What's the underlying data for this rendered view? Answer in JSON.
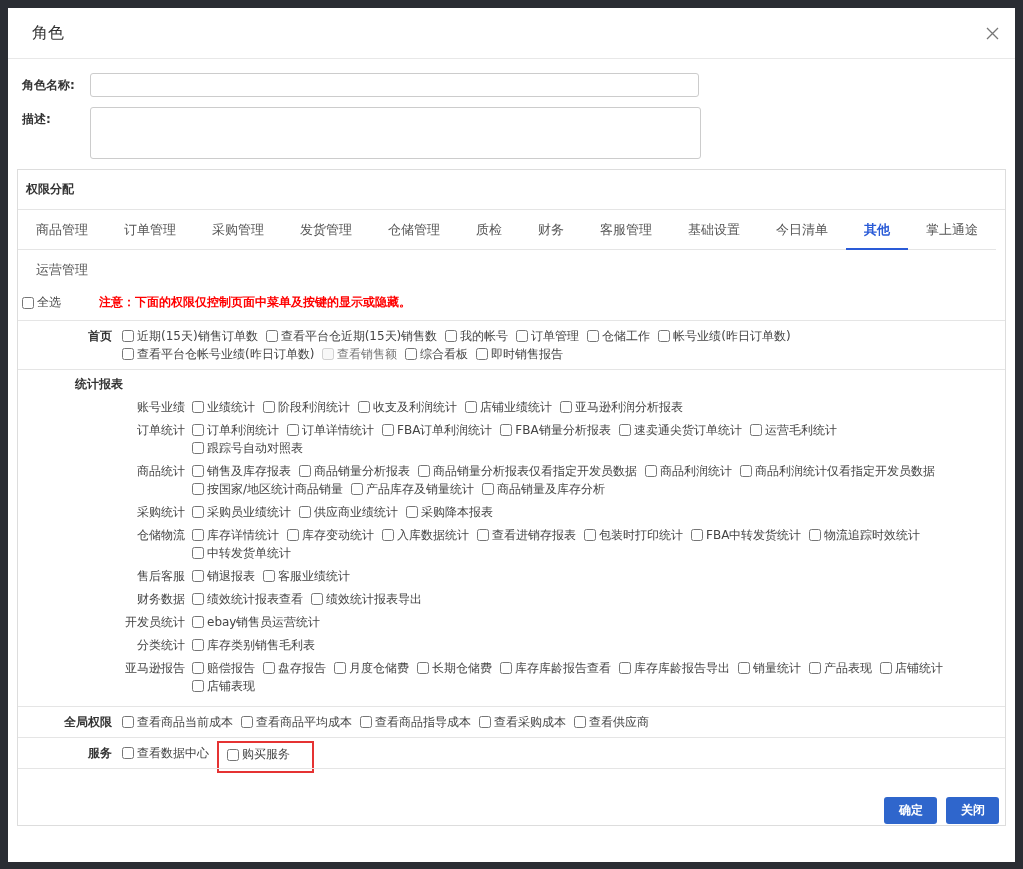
{
  "dialog": {
    "title": "角色"
  },
  "form": [
    {
      "kind": "input",
      "label": "角色名称:"
    },
    {
      "kind": "textarea",
      "label": "描述:"
    }
  ],
  "panel": {
    "title": "权限分配",
    "tabs": [
      {
        "label": "商品管理",
        "selected": false
      },
      {
        "label": "订单管理",
        "selected": false
      },
      {
        "label": "采购管理",
        "selected": false
      },
      {
        "label": "发货管理",
        "selected": false
      },
      {
        "label": "仓储管理",
        "selected": false
      },
      {
        "label": "质检",
        "selected": false
      },
      {
        "label": "财务",
        "selected": false
      },
      {
        "label": "客服管理",
        "selected": false
      },
      {
        "label": "基础设置",
        "selected": false
      },
      {
        "label": "今日清单",
        "selected": false
      },
      {
        "label": "其他",
        "selected": true
      },
      {
        "label": "掌上通途",
        "selected": false
      },
      {
        "label": "运营管理",
        "selected": false
      }
    ],
    "select_all": {
      "label": "全选",
      "checked": false
    },
    "notice": "注意：下面的权限仅控制页面中菜单及按键的显示或隐藏。",
    "sections": [
      {
        "kind": "flat",
        "label": "首页",
        "lines": [
          [
            {
              "label": "近期(15天)销售订单数",
              "checked": false,
              "disabled": false,
              "highlighted": false
            },
            {
              "label": "查看平台仓近期(15天)销售数",
              "checked": false,
              "disabled": false,
              "highlighted": false
            },
            {
              "label": "我的帐号",
              "checked": false,
              "disabled": false,
              "highlighted": false
            },
            {
              "label": "订单管理",
              "checked": false,
              "disabled": false,
              "highlighted": false
            },
            {
              "label": "仓储工作",
              "checked": false,
              "disabled": false,
              "highlighted": false
            },
            {
              "label": "帐号业绩(昨日订单数)",
              "checked": false,
              "disabled": false,
              "highlighted": false
            }
          ],
          [
            {
              "label": "查看平台仓帐号业绩(昨日订单数)",
              "checked": false,
              "disabled": false,
              "highlighted": false
            },
            {
              "label": "查看销售额",
              "checked": false,
              "disabled": true,
              "highlighted": false
            },
            {
              "label": "综合看板",
              "checked": false,
              "disabled": false,
              "highlighted": false
            },
            {
              "label": "即时销售报告",
              "checked": false,
              "disabled": false,
              "highlighted": false
            }
          ]
        ]
      },
      {
        "kind": "grouped",
        "label": "统计报表",
        "groups": [
          {
            "label": "账号业绩",
            "lines": [
              [
                {
                  "label": "业绩统计",
                  "checked": false,
                  "disabled": false,
                  "highlighted": false
                },
                {
                  "label": "阶段利润统计",
                  "checked": false,
                  "disabled": false,
                  "highlighted": false
                },
                {
                  "label": "收支及利润统计",
                  "checked": false,
                  "disabled": false,
                  "highlighted": false
                },
                {
                  "label": "店铺业绩统计",
                  "checked": false,
                  "disabled": false,
                  "highlighted": false
                },
                {
                  "label": "亚马逊利润分析报表",
                  "checked": false,
                  "disabled": false,
                  "highlighted": false
                }
              ]
            ]
          },
          {
            "label": "订单统计",
            "lines": [
              [
                {
                  "label": "订单利润统计",
                  "checked": false,
                  "disabled": false,
                  "highlighted": false
                },
                {
                  "label": "订单详情统计",
                  "checked": false,
                  "disabled": false,
                  "highlighted": false
                },
                {
                  "label": "FBA订单利润统计",
                  "checked": false,
                  "disabled": false,
                  "highlighted": false
                },
                {
                  "label": "FBA销量分析报表",
                  "checked": false,
                  "disabled": false,
                  "highlighted": false
                },
                {
                  "label": "速卖通尖货订单统计",
                  "checked": false,
                  "disabled": false,
                  "highlighted": false
                },
                {
                  "label": "运营毛利统计",
                  "checked": false,
                  "disabled": false,
                  "highlighted": false
                }
              ],
              [
                {
                  "label": "跟踪号自动对照表",
                  "checked": false,
                  "disabled": false,
                  "highlighted": false
                }
              ]
            ]
          },
          {
            "label": "商品统计",
            "lines": [
              [
                {
                  "label": "销售及库存报表",
                  "checked": false,
                  "disabled": false,
                  "highlighted": false
                },
                {
                  "label": "商品销量分析报表",
                  "checked": false,
                  "disabled": false,
                  "highlighted": false
                },
                {
                  "label": "商品销量分析报表仅看指定开发员数据",
                  "checked": false,
                  "disabled": false,
                  "highlighted": false
                },
                {
                  "label": "商品利润统计",
                  "checked": false,
                  "disabled": false,
                  "highlighted": false
                },
                {
                  "label": "商品利润统计仅看指定开发员数据",
                  "checked": false,
                  "disabled": false,
                  "highlighted": false
                }
              ],
              [
                {
                  "label": "按国家/地区统计商品销量",
                  "checked": false,
                  "disabled": false,
                  "highlighted": false
                },
                {
                  "label": "产品库存及销量统计",
                  "checked": false,
                  "disabled": false,
                  "highlighted": false
                },
                {
                  "label": "商品销量及库存分析",
                  "checked": false,
                  "disabled": false,
                  "highlighted": false
                }
              ]
            ]
          },
          {
            "label": "采购统计",
            "lines": [
              [
                {
                  "label": "采购员业绩统计",
                  "checked": false,
                  "disabled": false,
                  "highlighted": false
                },
                {
                  "label": "供应商业绩统计",
                  "checked": false,
                  "disabled": false,
                  "highlighted": false
                },
                {
                  "label": "采购降本报表",
                  "checked": false,
                  "disabled": false,
                  "highlighted": false
                }
              ]
            ]
          },
          {
            "label": "仓储物流",
            "lines": [
              [
                {
                  "label": "库存详情统计",
                  "checked": false,
                  "disabled": false,
                  "highlighted": false
                },
                {
                  "label": "库存变动统计",
                  "checked": false,
                  "disabled": false,
                  "highlighted": false
                },
                {
                  "label": "入库数据统计",
                  "checked": false,
                  "disabled": false,
                  "highlighted": false
                },
                {
                  "label": "查看进销存报表",
                  "checked": false,
                  "disabled": false,
                  "highlighted": false
                },
                {
                  "label": "包装时打印统计",
                  "checked": false,
                  "disabled": false,
                  "highlighted": false
                },
                {
                  "label": "FBA中转发货统计",
                  "checked": false,
                  "disabled": false,
                  "highlighted": false
                },
                {
                  "label": "物流追踪时效统计",
                  "checked": false,
                  "disabled": false,
                  "highlighted": false
                }
              ],
              [
                {
                  "label": "中转发货单统计",
                  "checked": false,
                  "disabled": false,
                  "highlighted": false
                }
              ]
            ]
          },
          {
            "label": "售后客服",
            "lines": [
              [
                {
                  "label": "销退报表",
                  "checked": false,
                  "disabled": false,
                  "highlighted": false
                },
                {
                  "label": "客服业绩统计",
                  "checked": false,
                  "disabled": false,
                  "highlighted": false
                }
              ]
            ]
          },
          {
            "label": "财务数据",
            "lines": [
              [
                {
                  "label": "绩效统计报表查看",
                  "checked": false,
                  "disabled": false,
                  "highlighted": false
                },
                {
                  "label": "绩效统计报表导出",
                  "checked": false,
                  "disabled": false,
                  "highlighted": false
                }
              ]
            ]
          },
          {
            "label": "开发员统计",
            "lines": [
              [
                {
                  "label": "ebay销售员运营统计",
                  "checked": false,
                  "disabled": false,
                  "highlighted": false
                }
              ]
            ]
          },
          {
            "label": "分类统计",
            "lines": [
              [
                {
                  "label": "库存类别销售毛利表",
                  "checked": false,
                  "disabled": false,
                  "highlighted": false
                }
              ]
            ]
          },
          {
            "label": "亚马逊报告",
            "lines": [
              [
                {
                  "label": "赔偿报告",
                  "checked": false,
                  "disabled": false,
                  "highlighted": false
                },
                {
                  "label": "盘存报告",
                  "checked": false,
                  "disabled": false,
                  "highlighted": false
                },
                {
                  "label": "月度仓储费",
                  "checked": false,
                  "disabled": false,
                  "highlighted": false
                },
                {
                  "label": "长期仓储费",
                  "checked": false,
                  "disabled": false,
                  "highlighted": false
                },
                {
                  "label": "库存库龄报告查看",
                  "checked": false,
                  "disabled": false,
                  "highlighted": false
                },
                {
                  "label": "库存库龄报告导出",
                  "checked": false,
                  "disabled": false,
                  "highlighted": false
                },
                {
                  "label": "销量统计",
                  "checked": false,
                  "disabled": false,
                  "highlighted": false
                },
                {
                  "label": "产品表现",
                  "checked": false,
                  "disabled": false,
                  "highlighted": false
                },
                {
                  "label": "店铺统计",
                  "checked": false,
                  "disabled": false,
                  "highlighted": false
                }
              ],
              [
                {
                  "label": "店铺表现",
                  "checked": false,
                  "disabled": false,
                  "highlighted": false
                }
              ]
            ]
          }
        ]
      },
      {
        "kind": "flat",
        "label": "全局权限",
        "lines": [
          [
            {
              "label": "查看商品当前成本",
              "checked": false,
              "disabled": false,
              "highlighted": false
            },
            {
              "label": "查看商品平均成本",
              "checked": false,
              "disabled": false,
              "highlighted": false
            },
            {
              "label": "查看商品指导成本",
              "checked": false,
              "disabled": false,
              "highlighted": false
            },
            {
              "label": "查看采购成本",
              "checked": false,
              "disabled": false,
              "highlighted": false
            },
            {
              "label": "查看供应商",
              "checked": false,
              "disabled": false,
              "highlighted": false
            }
          ]
        ]
      },
      {
        "kind": "flat",
        "label": "服务",
        "lines": [
          [
            {
              "label": "查看数据中心",
              "checked": false,
              "disabled": false,
              "highlighted": false
            },
            {
              "label": "购买服务",
              "checked": false,
              "disabled": false,
              "highlighted": true
            }
          ]
        ]
      }
    ],
    "buttons": [
      {
        "label": "确定"
      },
      {
        "label": "关闭"
      }
    ]
  }
}
